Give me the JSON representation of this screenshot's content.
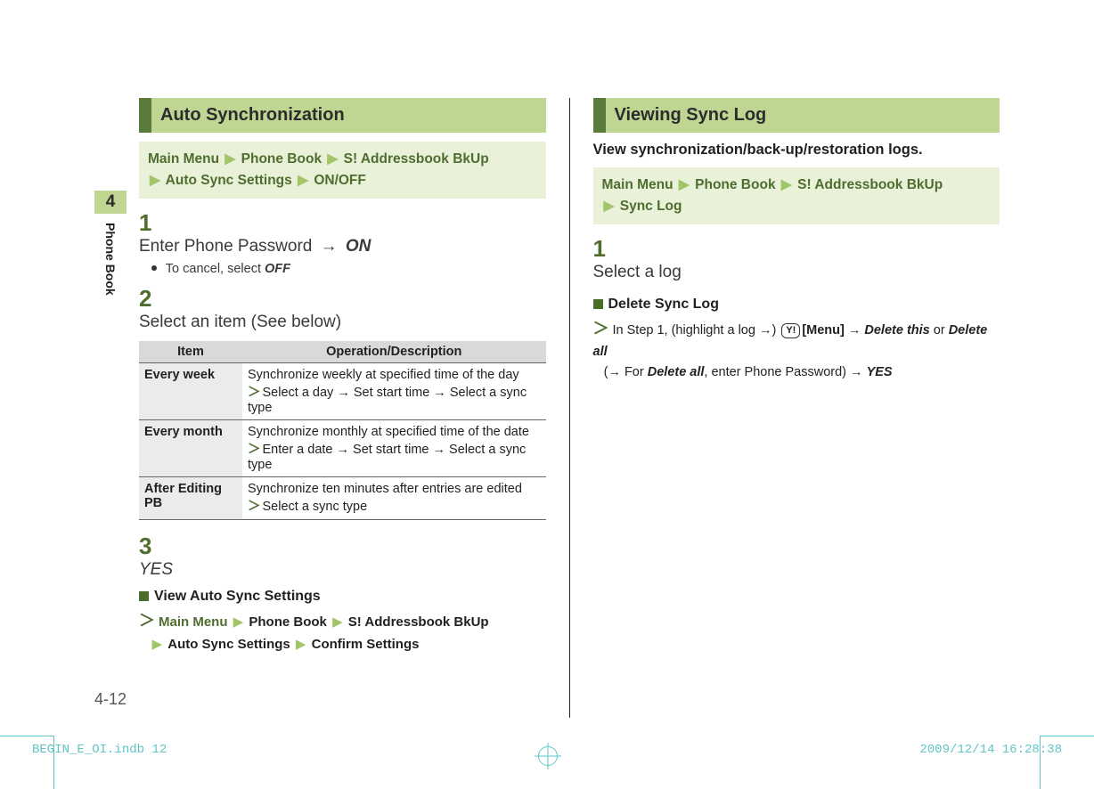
{
  "sidebar": {
    "chapter_number": "4",
    "chapter_name": "Phone Book"
  },
  "left": {
    "heading": "Auto Synchronization",
    "nav": {
      "segments": [
        "Main Menu",
        "Phone Book",
        "S! Addressbook BkUp",
        "Auto Sync Settings",
        "ON/OFF"
      ]
    },
    "steps": {
      "s1": {
        "num": "1",
        "main_a": "Enter Phone Password ",
        "main_b": "ON",
        "sub_a": "To cancel, select ",
        "sub_b": "OFF"
      },
      "s2": {
        "num": "2",
        "main": "Select an item (See below)"
      },
      "s3": {
        "num": "3",
        "main": "YES"
      }
    },
    "table": {
      "header_item": "Item",
      "header_desc": "Operation/Description",
      "rows": [
        {
          "item": "Every week",
          "line1": "Synchronize weekly at specified time of the day",
          "line2": "Select a day → Set start time → Select a sync type"
        },
        {
          "item": "Every month",
          "line1": "Synchronize monthly at specified time of the date",
          "line2": "Enter a date → Set start time → Select a sync type"
        },
        {
          "item": "After Editing PB",
          "line1": "Synchronize ten minutes after entries are edited",
          "line2": "Select a sync type"
        }
      ]
    },
    "sub": {
      "title": "View Auto Sync Settings",
      "segments": [
        "Main Menu",
        "Phone Book",
        "S! Addressbook BkUp",
        "Auto Sync Settings",
        "Confirm Settings"
      ]
    }
  },
  "right": {
    "heading": "Viewing Sync Log",
    "lead": "View synchronization/back-up/restoration logs.",
    "nav": {
      "segments": [
        "Main Menu",
        "Phone Book",
        "S! Addressbook BkUp",
        "Sync Log"
      ]
    },
    "steps": {
      "s1": {
        "num": "1",
        "main": "Select a log"
      }
    },
    "sub": {
      "title": "Delete Sync Log",
      "line_a": "In Step 1, (highlight a log →) ",
      "menu_key": "Y!",
      "line_b": "[Menu]",
      "line_c": " → ",
      "opt1": "Delete this",
      "line_d": " or ",
      "opt2": "Delete all",
      "line_e": "(→ For ",
      "opt3": "Delete all",
      "line_f": ", enter Phone Password) → ",
      "opt4": "YES"
    }
  },
  "page_num": "4-12",
  "footer": {
    "file": "BEGIN_E_OI.indb   12",
    "timestamp": "2009/12/14   16:28:38"
  }
}
